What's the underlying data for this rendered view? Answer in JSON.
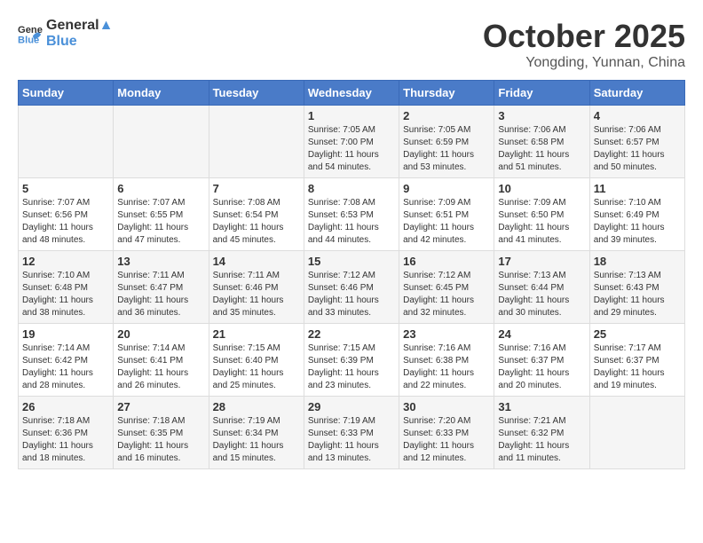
{
  "logo": {
    "general": "General",
    "blue": "Blue"
  },
  "title": "October 2025",
  "subtitle": "Yongding, Yunnan, China",
  "headers": [
    "Sunday",
    "Monday",
    "Tuesday",
    "Wednesday",
    "Thursday",
    "Friday",
    "Saturday"
  ],
  "weeks": [
    [
      {
        "day": "",
        "sunrise": "",
        "sunset": "",
        "daylight": ""
      },
      {
        "day": "",
        "sunrise": "",
        "sunset": "",
        "daylight": ""
      },
      {
        "day": "",
        "sunrise": "",
        "sunset": "",
        "daylight": ""
      },
      {
        "day": "1",
        "sunrise": "Sunrise: 7:05 AM",
        "sunset": "Sunset: 7:00 PM",
        "daylight": "Daylight: 11 hours and 54 minutes."
      },
      {
        "day": "2",
        "sunrise": "Sunrise: 7:05 AM",
        "sunset": "Sunset: 6:59 PM",
        "daylight": "Daylight: 11 hours and 53 minutes."
      },
      {
        "day": "3",
        "sunrise": "Sunrise: 7:06 AM",
        "sunset": "Sunset: 6:58 PM",
        "daylight": "Daylight: 11 hours and 51 minutes."
      },
      {
        "day": "4",
        "sunrise": "Sunrise: 7:06 AM",
        "sunset": "Sunset: 6:57 PM",
        "daylight": "Daylight: 11 hours and 50 minutes."
      }
    ],
    [
      {
        "day": "5",
        "sunrise": "Sunrise: 7:07 AM",
        "sunset": "Sunset: 6:56 PM",
        "daylight": "Daylight: 11 hours and 48 minutes."
      },
      {
        "day": "6",
        "sunrise": "Sunrise: 7:07 AM",
        "sunset": "Sunset: 6:55 PM",
        "daylight": "Daylight: 11 hours and 47 minutes."
      },
      {
        "day": "7",
        "sunrise": "Sunrise: 7:08 AM",
        "sunset": "Sunset: 6:54 PM",
        "daylight": "Daylight: 11 hours and 45 minutes."
      },
      {
        "day": "8",
        "sunrise": "Sunrise: 7:08 AM",
        "sunset": "Sunset: 6:53 PM",
        "daylight": "Daylight: 11 hours and 44 minutes."
      },
      {
        "day": "9",
        "sunrise": "Sunrise: 7:09 AM",
        "sunset": "Sunset: 6:51 PM",
        "daylight": "Daylight: 11 hours and 42 minutes."
      },
      {
        "day": "10",
        "sunrise": "Sunrise: 7:09 AM",
        "sunset": "Sunset: 6:50 PM",
        "daylight": "Daylight: 11 hours and 41 minutes."
      },
      {
        "day": "11",
        "sunrise": "Sunrise: 7:10 AM",
        "sunset": "Sunset: 6:49 PM",
        "daylight": "Daylight: 11 hours and 39 minutes."
      }
    ],
    [
      {
        "day": "12",
        "sunrise": "Sunrise: 7:10 AM",
        "sunset": "Sunset: 6:48 PM",
        "daylight": "Daylight: 11 hours and 38 minutes."
      },
      {
        "day": "13",
        "sunrise": "Sunrise: 7:11 AM",
        "sunset": "Sunset: 6:47 PM",
        "daylight": "Daylight: 11 hours and 36 minutes."
      },
      {
        "day": "14",
        "sunrise": "Sunrise: 7:11 AM",
        "sunset": "Sunset: 6:46 PM",
        "daylight": "Daylight: 11 hours and 35 minutes."
      },
      {
        "day": "15",
        "sunrise": "Sunrise: 7:12 AM",
        "sunset": "Sunset: 6:46 PM",
        "daylight": "Daylight: 11 hours and 33 minutes."
      },
      {
        "day": "16",
        "sunrise": "Sunrise: 7:12 AM",
        "sunset": "Sunset: 6:45 PM",
        "daylight": "Daylight: 11 hours and 32 minutes."
      },
      {
        "day": "17",
        "sunrise": "Sunrise: 7:13 AM",
        "sunset": "Sunset: 6:44 PM",
        "daylight": "Daylight: 11 hours and 30 minutes."
      },
      {
        "day": "18",
        "sunrise": "Sunrise: 7:13 AM",
        "sunset": "Sunset: 6:43 PM",
        "daylight": "Daylight: 11 hours and 29 minutes."
      }
    ],
    [
      {
        "day": "19",
        "sunrise": "Sunrise: 7:14 AM",
        "sunset": "Sunset: 6:42 PM",
        "daylight": "Daylight: 11 hours and 28 minutes."
      },
      {
        "day": "20",
        "sunrise": "Sunrise: 7:14 AM",
        "sunset": "Sunset: 6:41 PM",
        "daylight": "Daylight: 11 hours and 26 minutes."
      },
      {
        "day": "21",
        "sunrise": "Sunrise: 7:15 AM",
        "sunset": "Sunset: 6:40 PM",
        "daylight": "Daylight: 11 hours and 25 minutes."
      },
      {
        "day": "22",
        "sunrise": "Sunrise: 7:15 AM",
        "sunset": "Sunset: 6:39 PM",
        "daylight": "Daylight: 11 hours and 23 minutes."
      },
      {
        "day": "23",
        "sunrise": "Sunrise: 7:16 AM",
        "sunset": "Sunset: 6:38 PM",
        "daylight": "Daylight: 11 hours and 22 minutes."
      },
      {
        "day": "24",
        "sunrise": "Sunrise: 7:16 AM",
        "sunset": "Sunset: 6:37 PM",
        "daylight": "Daylight: 11 hours and 20 minutes."
      },
      {
        "day": "25",
        "sunrise": "Sunrise: 7:17 AM",
        "sunset": "Sunset: 6:37 PM",
        "daylight": "Daylight: 11 hours and 19 minutes."
      }
    ],
    [
      {
        "day": "26",
        "sunrise": "Sunrise: 7:18 AM",
        "sunset": "Sunset: 6:36 PM",
        "daylight": "Daylight: 11 hours and 18 minutes."
      },
      {
        "day": "27",
        "sunrise": "Sunrise: 7:18 AM",
        "sunset": "Sunset: 6:35 PM",
        "daylight": "Daylight: 11 hours and 16 minutes."
      },
      {
        "day": "28",
        "sunrise": "Sunrise: 7:19 AM",
        "sunset": "Sunset: 6:34 PM",
        "daylight": "Daylight: 11 hours and 15 minutes."
      },
      {
        "day": "29",
        "sunrise": "Sunrise: 7:19 AM",
        "sunset": "Sunset: 6:33 PM",
        "daylight": "Daylight: 11 hours and 13 minutes."
      },
      {
        "day": "30",
        "sunrise": "Sunrise: 7:20 AM",
        "sunset": "Sunset: 6:33 PM",
        "daylight": "Daylight: 11 hours and 12 minutes."
      },
      {
        "day": "31",
        "sunrise": "Sunrise: 7:21 AM",
        "sunset": "Sunset: 6:32 PM",
        "daylight": "Daylight: 11 hours and 11 minutes."
      },
      {
        "day": "",
        "sunrise": "",
        "sunset": "",
        "daylight": ""
      }
    ]
  ]
}
